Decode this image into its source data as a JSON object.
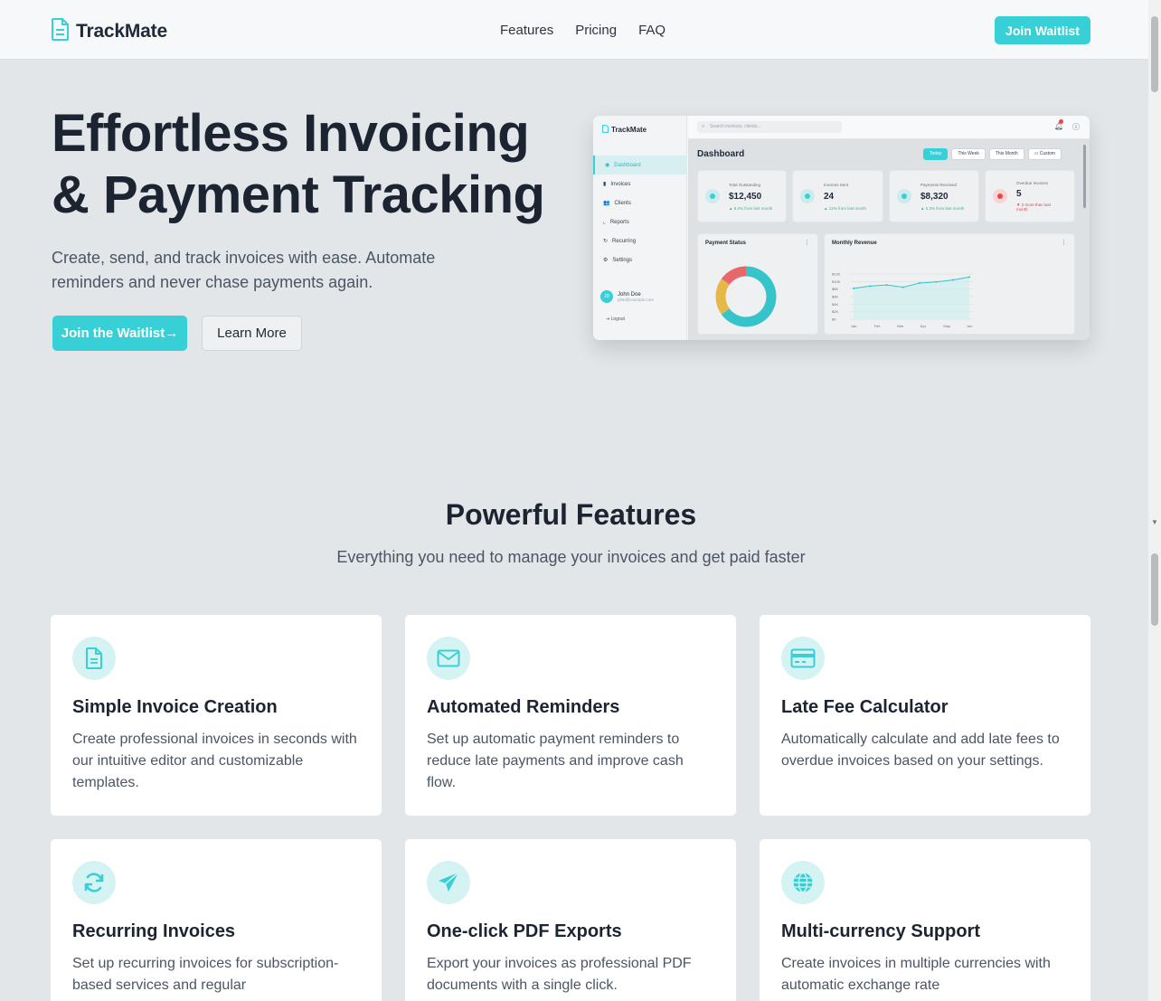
{
  "nav": {
    "brand": "TrackMate",
    "links": [
      "Features",
      "Pricing",
      "FAQ"
    ],
    "cta": "Join Waitlist"
  },
  "hero": {
    "title_line1": "Effortless Invoicing",
    "title_line2": "& Payment Tracking",
    "subtitle": "Create, send, and track invoices with ease. Automate reminders and never chase payments again.",
    "primary_cta": "Join the Waitlist",
    "secondary_cta": "Learn More"
  },
  "mockup": {
    "brand": "TrackMate",
    "search_placeholder": "Search invoices, clients...",
    "nav_items": [
      "Dashboard",
      "Invoices",
      "Clients",
      "Reports",
      "Recurring",
      "Settings"
    ],
    "user_name": "John Doe",
    "user_email": "john@example.com",
    "user_initials": "JD",
    "logout": "Logout",
    "heading": "Dashboard",
    "filters": [
      "Today",
      "This Week",
      "This Month",
      "Custom"
    ],
    "stats": [
      {
        "label": "Total Outstanding",
        "value": "$12,450",
        "sub": "▲ 8.2% from last month"
      },
      {
        "label": "Invoices Sent",
        "value": "24",
        "sub": "▲ 12% from last month"
      },
      {
        "label": "Payments Received",
        "value": "$8,320",
        "sub": "▲ 5.3% from last month"
      },
      {
        "label": "Overdue Invoices",
        "value": "5",
        "sub": "▼ 2 more than last month"
      }
    ],
    "panel_payment": "Payment Status",
    "panel_revenue": "Monthly Revenue",
    "donut_shares": [
      0.65,
      0.2,
      0.15
    ],
    "donut_colors": [
      "#36c3c9",
      "#e6b84a",
      "#e8676a"
    ],
    "revenue_months": [
      "Jan",
      "Feb",
      "Mar",
      "Apr",
      "May",
      "Jun"
    ],
    "revenue_yticks": [
      "$12K",
      "$10K",
      "$8K",
      "$6K",
      "$4K",
      "$2K",
      "$0"
    ],
    "revenue_values": [
      8.2,
      8.8,
      9.1,
      8.5,
      9.6,
      9.9,
      10.4,
      11.2
    ]
  },
  "features": {
    "title": "Powerful Features",
    "subtitle": "Everything you need to manage your invoices and get paid faster",
    "items": [
      {
        "icon": "document-icon",
        "title": "Simple Invoice Creation",
        "desc": "Create professional invoices in seconds with our intuitive editor and customizable templates."
      },
      {
        "icon": "envelope-icon",
        "title": "Automated Reminders",
        "desc": "Set up automatic payment reminders to reduce late payments and improve cash flow."
      },
      {
        "icon": "credit-card-icon",
        "title": "Late Fee Calculator",
        "desc": "Automatically calculate and add late fees to overdue invoices based on your settings."
      },
      {
        "icon": "refresh-icon",
        "title": "Recurring Invoices",
        "desc": "Set up recurring invoices for subscription-based services and regular"
      },
      {
        "icon": "paper-plane-icon",
        "title": "One-click PDF Exports",
        "desc": "Export your invoices as professional PDF documents with a single click."
      },
      {
        "icon": "globe-icon",
        "title": "Multi-currency Support",
        "desc": "Create invoices in multiple currencies with automatic exchange rate"
      }
    ]
  },
  "colors": {
    "accent": "#36d0d6",
    "text_dark": "#1c2431",
    "text_muted": "#4b5563",
    "page_bg": "#e2e6e8"
  }
}
